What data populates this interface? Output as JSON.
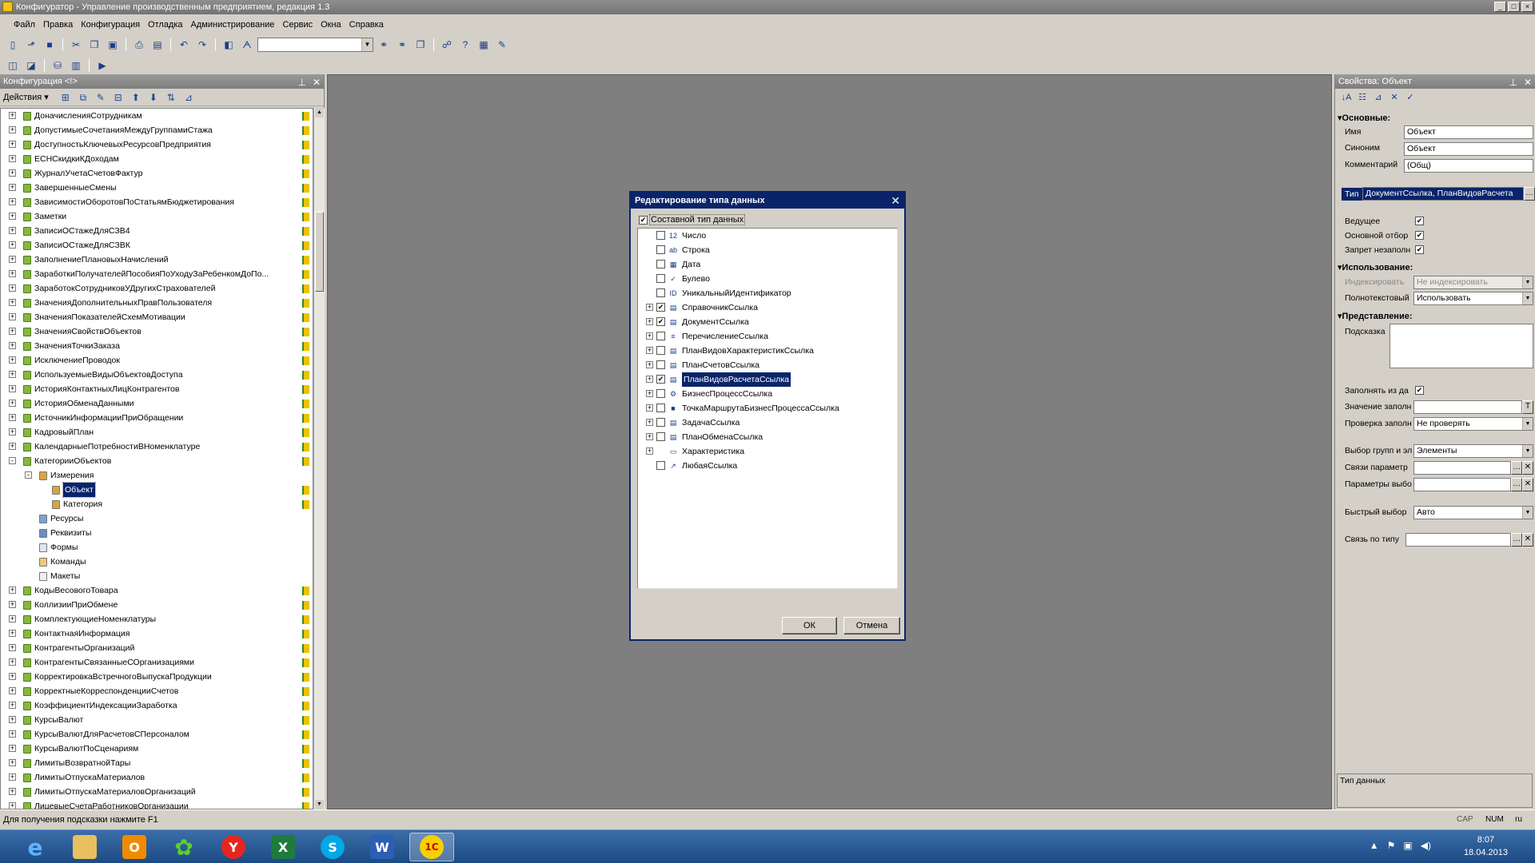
{
  "window": {
    "title": "Конфигуратор - Управление производственным предприятием, редакция 1.3",
    "buttons": [
      "_",
      "□",
      "×"
    ]
  },
  "menu": [
    "Файл",
    "Правка",
    "Конфигурация",
    "Отладка",
    "Администрирование",
    "Сервис",
    "Окна",
    "Справка"
  ],
  "toolbar": {
    "icons": [
      "new-doc",
      "open",
      "save",
      "cut",
      "copy",
      "paste",
      "print",
      "preview",
      "undo",
      "redo",
      "find",
      "find-next"
    ],
    "search_value": "",
    "icons2": [
      "binoculars",
      "binoculars-next",
      "windows",
      "syntax-helper",
      "help",
      "wizard",
      "debug"
    ]
  },
  "left_panel": {
    "title": "Конфигурация <!>",
    "actions_label": "Действия",
    "tree": [
      {
        "label": "ДоначисленияСотрудникам",
        "level": 1,
        "type": "reg",
        "expand": "+",
        "flag": true
      },
      {
        "label": "ДопустимыеСочетанияМеждуГруппамиСтажа",
        "level": 1,
        "type": "reg",
        "expand": "+",
        "flag": true
      },
      {
        "label": "ДоступностьКлючевыхРесурсовПредприятия",
        "level": 1,
        "type": "reg",
        "expand": "+",
        "flag": true
      },
      {
        "label": "ЕСНСкидкиКДоходам",
        "level": 1,
        "type": "reg",
        "expand": "+",
        "flag": true
      },
      {
        "label": "ЖурналУчетаСчетовФактур",
        "level": 1,
        "type": "reg",
        "expand": "+",
        "flag": true
      },
      {
        "label": "ЗавершенныеСмены",
        "level": 1,
        "type": "reg",
        "expand": "+",
        "flag": true
      },
      {
        "label": "ЗависимостиОборотовПоСтатьямБюджетирования",
        "level": 1,
        "type": "reg",
        "expand": "+",
        "flag": true
      },
      {
        "label": "Заметки",
        "level": 1,
        "type": "reg",
        "expand": "+",
        "flag": true
      },
      {
        "label": "ЗаписиОСтажеДляСЗВ4",
        "level": 1,
        "type": "reg",
        "expand": "+",
        "flag": true
      },
      {
        "label": "ЗаписиОСтажеДляСЗВК",
        "level": 1,
        "type": "reg",
        "expand": "+",
        "flag": true
      },
      {
        "label": "ЗаполнениеПлановыхНачислений",
        "level": 1,
        "type": "reg",
        "expand": "+",
        "flag": true
      },
      {
        "label": "ЗаработкиПолучателейПособияПоУходуЗаРебенкомДоПо...",
        "level": 1,
        "type": "reg",
        "expand": "+",
        "flag": true
      },
      {
        "label": "ЗаработокСотрудниковУДругихСтрахователей",
        "level": 1,
        "type": "reg",
        "expand": "+",
        "flag": true
      },
      {
        "label": "ЗначенияДополнительныхПравПользователя",
        "level": 1,
        "type": "reg",
        "expand": "+",
        "flag": true
      },
      {
        "label": "ЗначенияПоказателейСхемМотивации",
        "level": 1,
        "type": "reg",
        "expand": "+",
        "flag": true
      },
      {
        "label": "ЗначенияСвойствОбъектов",
        "level": 1,
        "type": "reg",
        "expand": "+",
        "flag": true
      },
      {
        "label": "ЗначенияТочкиЗаказа",
        "level": 1,
        "type": "reg",
        "expand": "+",
        "flag": true
      },
      {
        "label": "ИсключениеПроводок",
        "level": 1,
        "type": "reg",
        "expand": "+",
        "flag": true
      },
      {
        "label": "ИспользуемыеВидыОбъектовДоступа",
        "level": 1,
        "type": "reg",
        "expand": "+",
        "flag": true
      },
      {
        "label": "ИсторияКонтактныхЛицКонтрагентов",
        "level": 1,
        "type": "reg",
        "expand": "+",
        "flag": true
      },
      {
        "label": "ИсторияОбменаДанными",
        "level": 1,
        "type": "reg",
        "expand": "+",
        "flag": true
      },
      {
        "label": "ИсточникИнформацииПриОбращении",
        "level": 1,
        "type": "reg",
        "expand": "+",
        "flag": true
      },
      {
        "label": "КадровыйПлан",
        "level": 1,
        "type": "reg",
        "expand": "+",
        "flag": true
      },
      {
        "label": "КалендарныеПотребностиВНоменклатуре",
        "level": 1,
        "type": "reg",
        "expand": "+",
        "flag": true
      },
      {
        "label": "КатегорииОбъектов",
        "level": 1,
        "type": "reg",
        "expand": "-",
        "flag": true
      },
      {
        "label": "Измерения",
        "level": 2,
        "type": "dims",
        "expand": "-",
        "flag": false
      },
      {
        "label": "Объект",
        "level": 3,
        "type": "dim",
        "expand": "",
        "flag": true,
        "selected": true
      },
      {
        "label": "Категория",
        "level": 3,
        "type": "dim",
        "expand": "",
        "flag": true
      },
      {
        "label": "Ресурсы",
        "level": 2,
        "type": "res",
        "expand": "",
        "flag": false
      },
      {
        "label": "Реквизиты",
        "level": 2,
        "type": "attr",
        "expand": "",
        "flag": false
      },
      {
        "label": "Формы",
        "level": 2,
        "type": "forms",
        "expand": "",
        "flag": false
      },
      {
        "label": "Команды",
        "level": 2,
        "type": "cmd",
        "expand": "",
        "flag": false
      },
      {
        "label": "Макеты",
        "level": 2,
        "type": "tmpl",
        "expand": "",
        "flag": false
      },
      {
        "label": "КодыВесовогоТовара",
        "level": 1,
        "type": "reg",
        "expand": "+",
        "flag": true
      },
      {
        "label": "КоллизииПриОбмене",
        "level": 1,
        "type": "reg",
        "expand": "+",
        "flag": true
      },
      {
        "label": "КомплектующиеНоменклатуры",
        "level": 1,
        "type": "reg",
        "expand": "+",
        "flag": true
      },
      {
        "label": "КонтактнаяИнформация",
        "level": 1,
        "type": "reg",
        "expand": "+",
        "flag": true
      },
      {
        "label": "КонтрагентыОрганизаций",
        "level": 1,
        "type": "reg",
        "expand": "+",
        "flag": true
      },
      {
        "label": "КонтрагентыСвязанныеСОрганизациями",
        "level": 1,
        "type": "reg",
        "expand": "+",
        "flag": true
      },
      {
        "label": "КорректировкаВстречногоВыпускаПродукции",
        "level": 1,
        "type": "reg",
        "expand": "+",
        "flag": true
      },
      {
        "label": "КорректныеКорреспонденцииСчетов",
        "level": 1,
        "type": "reg",
        "expand": "+",
        "flag": true
      },
      {
        "label": "КоэффициентИндексацииЗаработка",
        "level": 1,
        "type": "reg",
        "expand": "+",
        "flag": true
      },
      {
        "label": "КурсыВалют",
        "level": 1,
        "type": "reg",
        "expand": "+",
        "flag": true
      },
      {
        "label": "КурсыВалютДляРасчетовСПерсоналом",
        "level": 1,
        "type": "reg",
        "expand": "+",
        "flag": true
      },
      {
        "label": "КурсыВалютПоСценариям",
        "level": 1,
        "type": "reg",
        "expand": "+",
        "flag": true
      },
      {
        "label": "ЛимитыВозвратнойТары",
        "level": 1,
        "type": "reg",
        "expand": "+",
        "flag": true
      },
      {
        "label": "ЛимитыОтпускаМатериалов",
        "level": 1,
        "type": "reg",
        "expand": "+",
        "flag": true
      },
      {
        "label": "ЛимитыОтпускаМатериаловОрганизаций",
        "level": 1,
        "type": "reg",
        "expand": "+",
        "flag": true
      },
      {
        "label": "ЛицевыеСчетаРаботниковОрганизации",
        "level": 1,
        "type": "reg",
        "expand": "+",
        "flag": true
      }
    ]
  },
  "dialog": {
    "title": "Редактирование типа данных",
    "composite_label": "Составной тип данных",
    "composite_checked": true,
    "types": [
      {
        "label": "Число",
        "expand": "",
        "checked": false,
        "icon": "12"
      },
      {
        "label": "Строка",
        "expand": "",
        "checked": false,
        "icon": "ab"
      },
      {
        "label": "Дата",
        "expand": "",
        "checked": false,
        "icon": "▦"
      },
      {
        "label": "Булево",
        "expand": "",
        "checked": false,
        "icon": "✓"
      },
      {
        "label": "УникальныйИдентификатор",
        "expand": "",
        "checked": false,
        "icon": "ID"
      },
      {
        "label": "СправочникСсылка",
        "expand": "+",
        "checked": true,
        "icon": "▤"
      },
      {
        "label": "ДокументСсылка",
        "expand": "+",
        "checked": true,
        "icon": "▤"
      },
      {
        "label": "ПеречислениеСсылка",
        "expand": "+",
        "checked": false,
        "icon": "≡"
      },
      {
        "label": "ПланВидовХарактеристикСсылка",
        "expand": "+",
        "checked": false,
        "icon": "▤"
      },
      {
        "label": "ПланСчетовСсылка",
        "expand": "+",
        "checked": false,
        "icon": "▤"
      },
      {
        "label": "ПланВидовРасчетаСсылка",
        "expand": "+",
        "checked": true,
        "icon": "▤",
        "selected": true
      },
      {
        "label": "БизнесПроцессСсылка",
        "expand": "+",
        "checked": false,
        "icon": "⚙"
      },
      {
        "label": "ТочкаМаршрутаБизнесПроцессаСсылка",
        "expand": "+",
        "checked": false,
        "icon": "■"
      },
      {
        "label": "ЗадачаСсылка",
        "expand": "+",
        "checked": false,
        "icon": "▤"
      },
      {
        "label": "ПланОбменаСсылка",
        "expand": "+",
        "checked": false,
        "icon": "▤"
      },
      {
        "label": "Характеристика",
        "expand": "+",
        "checked": null,
        "icon": "▭"
      },
      {
        "label": "ЛюбаяСсылка",
        "expand": "",
        "checked": false,
        "icon": "↗"
      }
    ],
    "ok_label": "ОК",
    "cancel_label": "Отмена"
  },
  "right_panel": {
    "title": "Свойства: Объект",
    "sections": {
      "basic": "Основные:",
      "usage": "Использование:",
      "presentation": "Представление:"
    },
    "fields": {
      "name_label": "Имя",
      "name_value": "Объект",
      "synonym_label": "Синоним",
      "synonym_value": "Объект",
      "comment_label": "Комментарий",
      "comment_value": "(Общ)",
      "type_label": "Тип",
      "type_value": "ДокументСсылка, ПланВидовРасчета",
      "master_label": "Ведущее",
      "main_filter_label": "Основной отбор",
      "deny_empty_label": "Запрет незаполн",
      "index_label": "Индексировать",
      "index_value": "Не индексировать",
      "fulltext_label": "Полнотекстовый",
      "fulltext_value": "Использовать",
      "hint_label": "Подсказка",
      "hint_value": "",
      "fill_from_label": "Заполнять из да",
      "fill_value_label": "Значение заполн",
      "fill_value_value": "",
      "fill_check_label": "Проверка заполн",
      "fill_check_value": "Не проверять",
      "group_select_label": "Выбор групп и эл",
      "group_select_value": "Элементы",
      "param_links_label": "Связи параметр",
      "param_links_value": "",
      "choice_params_label": "Параметры выбо",
      "choice_params_value": "",
      "quick_choice_label": "Быстрый выбор",
      "quick_choice_value": "Авто",
      "type_link_label": "Связь по типу",
      "type_link_value": ""
    },
    "type_desc": "Тип данных"
  },
  "status": {
    "text": "Для получения подсказки нажмите F1",
    "caps": "CAP",
    "num": "NUM",
    "lang": "ru"
  },
  "taskbar": {
    "apps": [
      "internet-explorer",
      "explorer",
      "outlook",
      "icq",
      "yandex",
      "excel",
      "skype",
      "word",
      "1c"
    ],
    "time": "8:07",
    "date": "18.04.2013"
  }
}
